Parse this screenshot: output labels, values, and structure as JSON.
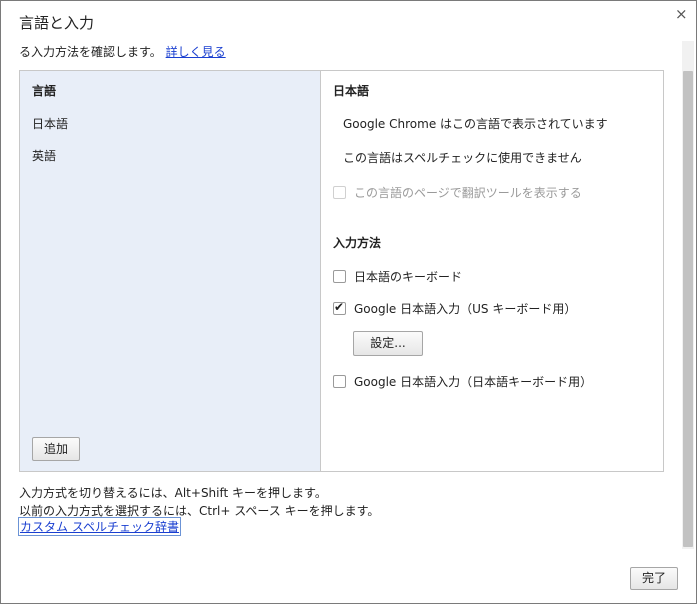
{
  "dialog": {
    "title": "言語と入力",
    "close_icon": "close-icon"
  },
  "intro": {
    "text": "る入力方法を確認します。",
    "link": "詳しく見る"
  },
  "languages": {
    "header": "言語",
    "items": [
      {
        "label": "日本語"
      },
      {
        "label": "英語"
      }
    ],
    "add_button": "追加"
  },
  "settings": {
    "language_title": "日本語",
    "display_info": "Google Chrome はこの言語で表示されています",
    "spellcheck_info": "この言語はスペルチェックに使用できません",
    "translate_checkbox": {
      "label": "この言語のページで翻訳ツールを表示する",
      "checked": false,
      "disabled": true
    },
    "input_methods_title": "入力方法",
    "input_methods": [
      {
        "label": "日本語のキーボード",
        "checked": false
      },
      {
        "label": "Google 日本語入力（US キーボード用）",
        "checked": true
      },
      {
        "label": "Google 日本語入力（日本語キーボード用）",
        "checked": false
      }
    ],
    "settings_button": "設定..."
  },
  "footer": {
    "line1": "入力方式を切り替えるには、Alt+Shift キーを押します。",
    "line2": "以前の入力方式を選択するには、Ctrl+ スペース キーを押します。",
    "spellcheck_link": "カスタム スペルチェック辞書",
    "done_button": "完了"
  }
}
